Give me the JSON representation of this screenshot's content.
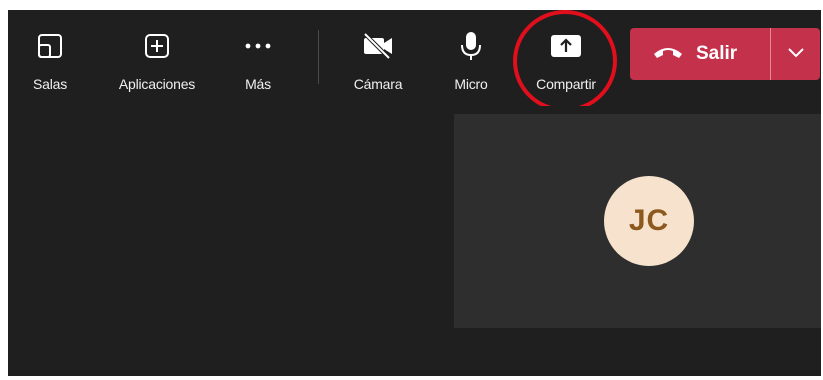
{
  "toolbar": {
    "buttons": [
      {
        "label": "Salas",
        "icon": "breakout-rooms-icon"
      },
      {
        "label": "Aplicaciones",
        "icon": "add-apps-icon"
      },
      {
        "label": "Más",
        "icon": "more-options-icon"
      },
      {
        "label": "Cámara",
        "icon": "camera-off-icon"
      },
      {
        "label": "Micro",
        "icon": "microphone-icon"
      },
      {
        "label": "Compartir",
        "icon": "share-screen-icon"
      }
    ],
    "leave": {
      "label": "Salir",
      "icon": "hang-up-icon",
      "dropdown_icon": "chevron-down-icon"
    }
  },
  "highlight": {
    "target": "Compartir",
    "color": "#e10f1c"
  },
  "participant": {
    "initials": "JC",
    "avatar_bg": "#f7e3cd",
    "avatar_fg": "#8c5a1f"
  },
  "colors": {
    "background": "#1f1f1f",
    "tile": "#2e2e2e",
    "leave": "#c4314b"
  }
}
